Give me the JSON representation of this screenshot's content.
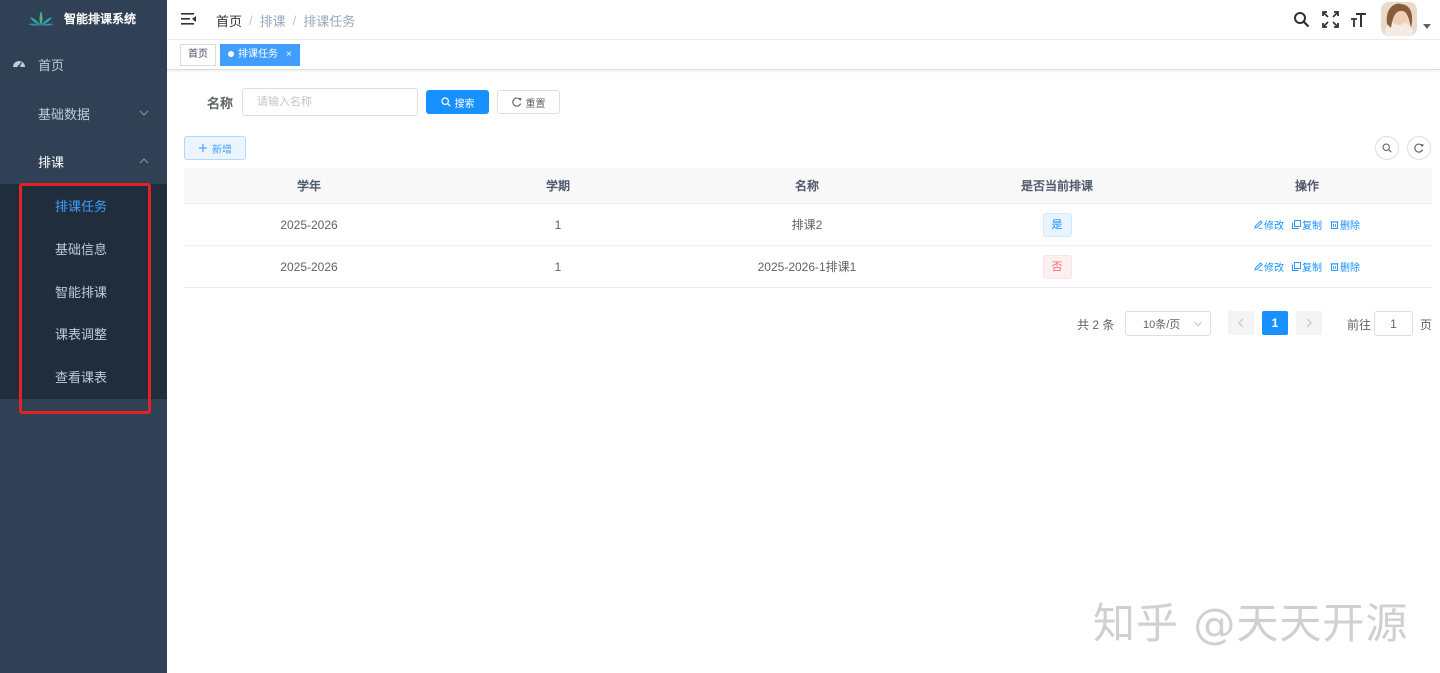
{
  "app": {
    "title": "智能排课系统",
    "brand_color": "#409eff",
    "sidebar_bg": "#304156",
    "logo_icon": "lotus-logo-icon"
  },
  "sidebar": {
    "items": [
      {
        "label": "首页",
        "icon": "dashboard-icon"
      },
      {
        "label": "基础数据",
        "icon": "",
        "chevron": "chevron-down-icon"
      },
      {
        "label": "排课",
        "icon": "",
        "chevron": "chevron-up-icon"
      }
    ],
    "submenu": [
      {
        "label": "排课任务",
        "active": true
      },
      {
        "label": "基础信息"
      },
      {
        "label": "智能排课"
      },
      {
        "label": "课表调整"
      },
      {
        "label": "查看课表"
      }
    ]
  },
  "navbar": {
    "breadcrumb": [
      "首页",
      "排课",
      "排课任务"
    ],
    "separator": "/",
    "icons": [
      "search-icon",
      "fullscreen-icon",
      "font-size-icon",
      "avatar",
      "caret-down-icon"
    ]
  },
  "tags": [
    {
      "label": "首页"
    },
    {
      "label": "排课任务",
      "active": true,
      "close": "×"
    }
  ],
  "search": {
    "label": "名称",
    "placeholder": "请输入名称",
    "search_button": "搜索",
    "reset_button": "重置"
  },
  "toolbar": {
    "add_button": "新增"
  },
  "table": {
    "columns": [
      "学年",
      "学期",
      "名称",
      "是否当前排课",
      "操作"
    ],
    "rows": [
      {
        "year": "2025-2026",
        "term": "1",
        "name": "排课2",
        "current": "是",
        "current_status": "yes"
      },
      {
        "year": "2025-2026",
        "term": "1",
        "name": "2025-2026-1排课1",
        "current": "否",
        "current_status": "no"
      }
    ],
    "actions": {
      "edit": "修改",
      "copy": "复制",
      "delete": "删除"
    }
  },
  "pagination": {
    "total": "共 2 条",
    "page_size": "10条/页",
    "current_page": "1",
    "goto_label": "前往",
    "goto_value": "1",
    "goto_unit": "页"
  },
  "watermark": "知乎 @天天开源"
}
